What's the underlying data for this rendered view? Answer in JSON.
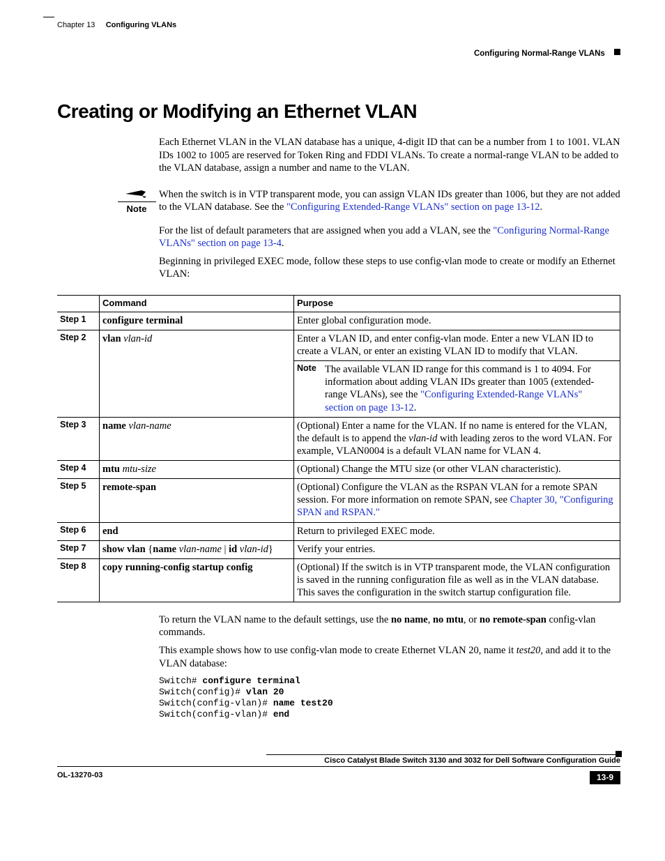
{
  "header": {
    "chapter_label": "Chapter 13",
    "chapter_title": "Configuring VLANs",
    "section_running": "Configuring Normal-Range VLANs"
  },
  "heading": "Creating or Modifying an Ethernet VLAN",
  "intro_para": "Each Ethernet VLAN in the VLAN database has a unique, 4-digit ID that can be a number from 1 to 1001. VLAN IDs 1002 to 1005 are reserved for Token Ring and FDDI VLANs. To create a normal-range VLAN to be added to the VLAN database, assign a number and name to the VLAN.",
  "note": {
    "label": "Note",
    "text_lead": "When the switch is in VTP transparent mode, you can assign VLAN IDs greater than 1006, but they are not added to the VLAN database. See the ",
    "link_text": "\"Configuring Extended-Range VLANs\" section on page 13-12",
    "text_tail": "."
  },
  "para_after_note_lead": "For the list of default parameters that are assigned when you add a VLAN, see the ",
  "para_after_note_link": "\"Configuring Normal-Range VLANs\" section on page 13-4",
  "para_after_note_tail": ".",
  "para_steps_intro": "Beginning in privileged EXEC mode, follow these steps to use config-vlan mode to create or modify an Ethernet VLAN:",
  "table": {
    "headers": {
      "command": "Command",
      "purpose": "Purpose"
    },
    "steps": [
      {
        "step": "Step 1",
        "command_segments": [
          {
            "t": "configure terminal",
            "b": true
          }
        ],
        "purpose_segments": [
          {
            "t": "Enter global configuration mode."
          }
        ]
      },
      {
        "step": "Step 2",
        "command_segments": [
          {
            "t": "vlan ",
            "b": true
          },
          {
            "t": "vlan-id",
            "i": true
          }
        ],
        "purpose_top": "Enter a VLAN ID, and enter config-vlan mode. Enter a new VLAN ID to create a VLAN, or enter an existing VLAN ID to modify that VLAN.",
        "inline_note_label": "Note",
        "inline_note_lead": "The available VLAN ID range for this command is 1 to 4094. For information about adding VLAN IDs greater than 1005 (extended-range VLANs), see the ",
        "inline_note_link": "\"Configuring Extended-Range VLANs\" section on page 13-12",
        "inline_note_tail": "."
      },
      {
        "step": "Step 3",
        "command_segments": [
          {
            "t": "name ",
            "b": true
          },
          {
            "t": "vlan-name",
            "i": true
          }
        ],
        "purpose_lead": "(Optional) Enter a name for the VLAN. If no name is entered for the VLAN, the default is to append the ",
        "purpose_italic": "vlan-id",
        "purpose_tail": " with leading zeros to the word VLAN. For example, VLAN0004 is a default VLAN name for VLAN 4."
      },
      {
        "step": "Step 4",
        "command_segments": [
          {
            "t": "mtu ",
            "b": true
          },
          {
            "t": "mtu-size",
            "i": true
          }
        ],
        "purpose_segments": [
          {
            "t": "(Optional) Change the MTU size (or other VLAN characteristic)."
          }
        ]
      },
      {
        "step": "Step 5",
        "command_segments": [
          {
            "t": "remote-span",
            "b": true
          }
        ],
        "purpose_lead": "(Optional) Configure the VLAN as the RSPAN VLAN for a remote SPAN session. For more information on remote SPAN, see ",
        "purpose_link": "Chapter 30, \"Configuring SPAN and RSPAN.\""
      },
      {
        "step": "Step 6",
        "command_segments": [
          {
            "t": "end",
            "b": true
          }
        ],
        "purpose_segments": [
          {
            "t": "Return to privileged EXEC mode."
          }
        ]
      },
      {
        "step": "Step 7",
        "command_segments": [
          {
            "t": "show vlan ",
            "b": true
          },
          {
            "t": "{"
          },
          {
            "t": "name ",
            "b": true
          },
          {
            "t": "vlan-name",
            "i": true
          },
          {
            "t": " | "
          },
          {
            "t": "id ",
            "b": true
          },
          {
            "t": "vlan-id",
            "i": true
          },
          {
            "t": "}"
          }
        ],
        "purpose_segments": [
          {
            "t": "Verify your entries."
          }
        ]
      },
      {
        "step": "Step 8",
        "command_segments": [
          {
            "t": "copy running-config startup config",
            "b": true
          }
        ],
        "purpose_segments": [
          {
            "t": "(Optional) If the switch is in VTP transparent mode, the VLAN configuration is saved in the running configuration file as well as in the VLAN database. This saves the configuration in the switch startup configuration file."
          }
        ]
      }
    ]
  },
  "after_table": {
    "p1_lead": "To return the VLAN name to the default settings, use the ",
    "no_name": "no name",
    "comma1": ", ",
    "no_mtu": "no mtu",
    "or": ", or ",
    "no_remote_span": "no remote-span",
    "p1_tail": " config-vlan commands.",
    "p2_lead": "This example shows how to use config-vlan mode to create Ethernet VLAN 20, name it ",
    "test20": "test20,",
    "p2_tail": " and add it to the VLAN database:"
  },
  "terminal": {
    "l1_prompt": "Switch# ",
    "l1_cmd": "configure terminal",
    "l2_prompt": "Switch(config)# ",
    "l2_cmd": "vlan 20",
    "l3_prompt": "Switch(config-vlan)# ",
    "l3_cmd": "name test20",
    "l4_prompt": "Switch(config-vlan)# ",
    "l4_cmd": "end"
  },
  "footer": {
    "title": "Cisco Catalyst Blade Switch 3130 and 3032 for Dell Software Configuration Guide",
    "doc_id": "OL-13270-03",
    "page": "13-9"
  }
}
